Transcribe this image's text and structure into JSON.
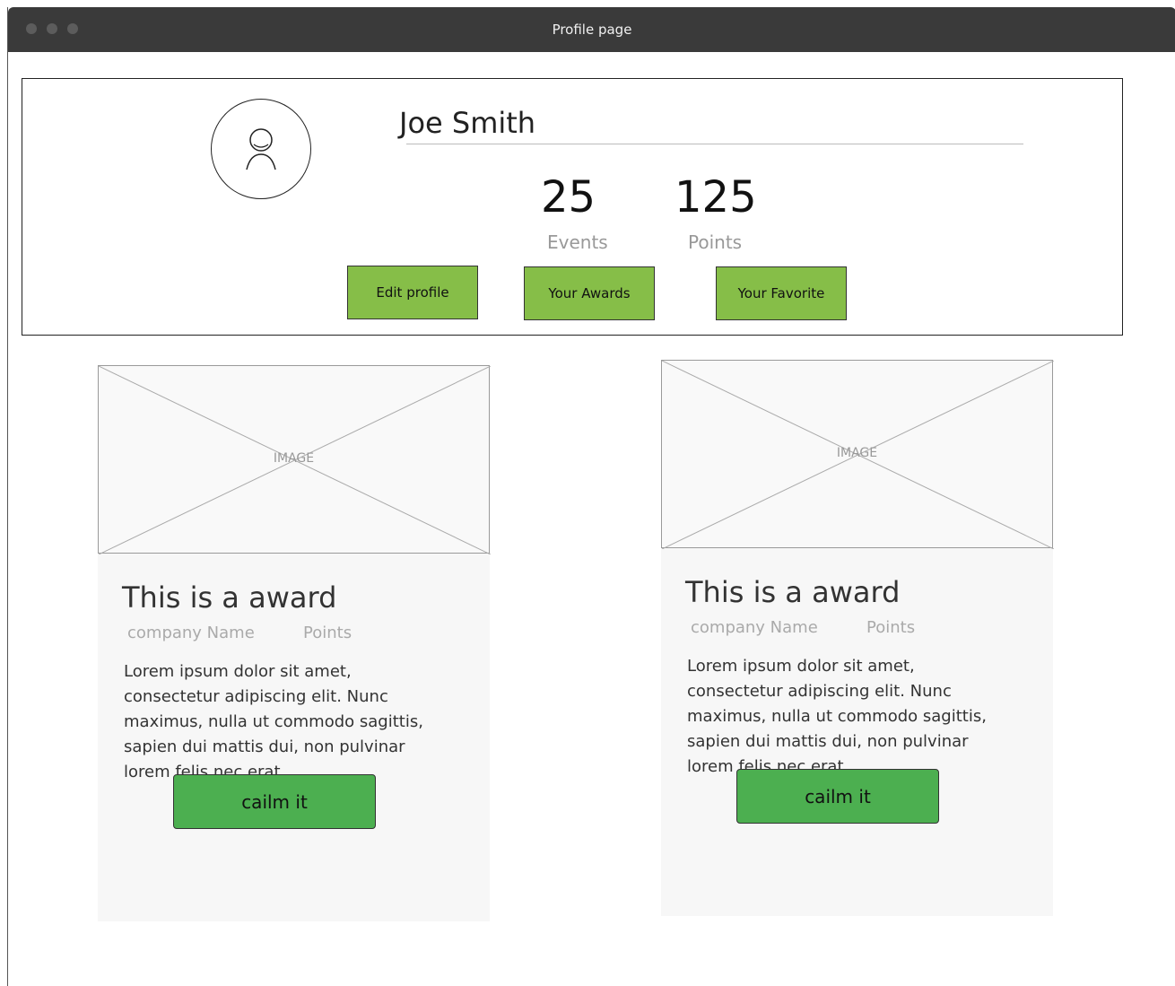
{
  "window": {
    "title": "Profile page"
  },
  "profile": {
    "name": "Joe Smith",
    "stats": [
      {
        "value": "25",
        "label": "Events"
      },
      {
        "value": "125",
        "label": "Points"
      }
    ],
    "buttons": {
      "edit": "Edit profile",
      "awards": "Your Awards",
      "favorite": "Your Favorite"
    }
  },
  "cards": [
    {
      "image_label": "IMAGE",
      "title": "This is a award",
      "company": "company Name",
      "points": "Points",
      "description": "Lorem ipsum dolor sit amet, consectetur adipiscing elit. Nunc maximus, nulla ut commodo sagittis, sapien dui mattis dui, non pulvinar lorem felis nec erat",
      "button": "cailm it"
    },
    {
      "image_label": "IMAGE",
      "title": "This is a award",
      "company": "company Name",
      "points": "Points",
      "description": "Lorem ipsum dolor sit amet, consectetur adipiscing elit. Nunc maximus, nulla ut commodo sagittis, sapien dui mattis dui, non pulvinar lorem felis nec erat",
      "button": "cailm it"
    }
  ],
  "colors": {
    "titlebar": "#3a3a3a",
    "profile_button": "#86be48",
    "claim_button": "#4caf50"
  }
}
